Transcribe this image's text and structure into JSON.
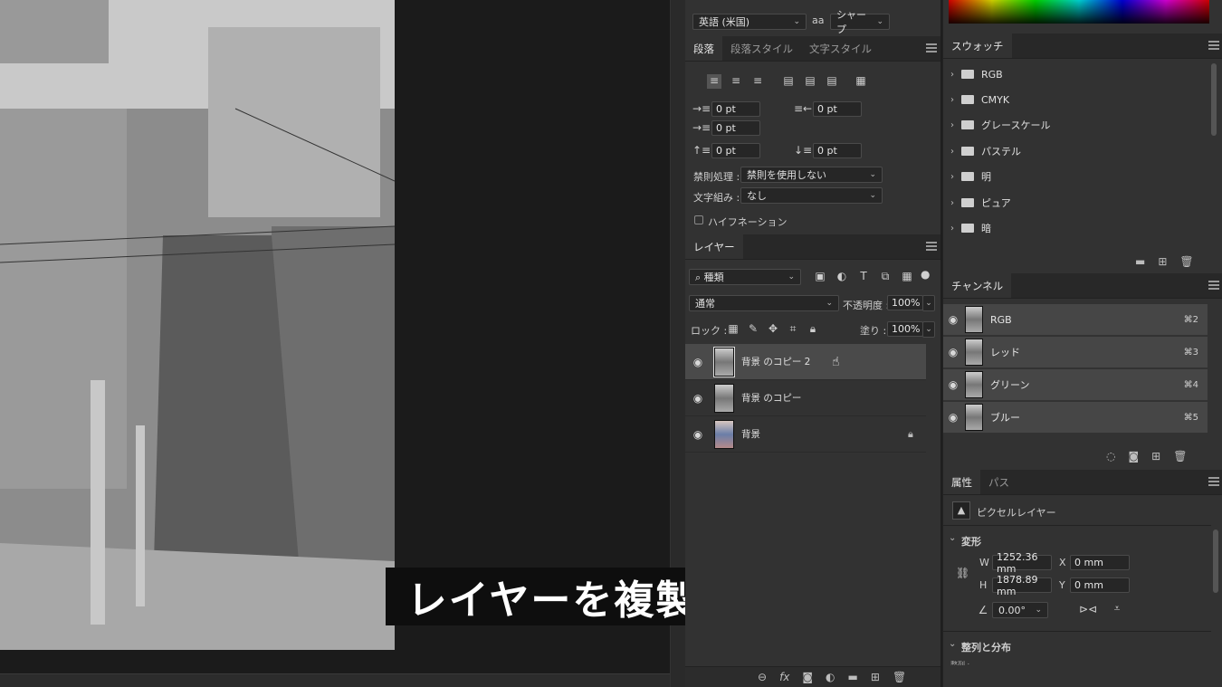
{
  "subtitle": "レイヤーを複製します",
  "character": {
    "language_dropdown": "英語 (米国)",
    "aa_icon": "aa",
    "antialias_dropdown": "シャープ"
  },
  "paragraph_panel": {
    "tabs": [
      "段落",
      "段落スタイル",
      "文字スタイル"
    ],
    "indent_left": "0 pt",
    "indent_right": "0 pt",
    "indent_first": "0 pt",
    "space_before": "0 pt",
    "space_after": "0 pt",
    "kinsoku_label": "禁則処理 :",
    "kinsoku_value": "禁則を使用しない",
    "mojikumi_label": "文字組み :",
    "mojikumi_value": "なし",
    "hyphenation_label": "ハイフネーション"
  },
  "layers_panel": {
    "tab": "レイヤー",
    "filter_label": "種類",
    "blend_mode": "通常",
    "opacity_label": "不透明度 :",
    "opacity_value": "100%",
    "lock_label": "ロック :",
    "fill_label": "塗り :",
    "fill_value": "100%",
    "layers": [
      {
        "name": "背景 のコピー 2",
        "selected": true,
        "locked": false
      },
      {
        "name": "背景 のコピー",
        "selected": false,
        "locked": false
      },
      {
        "name": "背景",
        "selected": false,
        "locked": true
      }
    ],
    "footer_icons": [
      "link-icon",
      "fx-icon",
      "mask-icon",
      "adjustment-icon",
      "folder-icon",
      "new-layer-icon",
      "trash-icon"
    ]
  },
  "swatches_panel": {
    "tab": "スウォッチ",
    "groups": [
      "RGB",
      "CMYK",
      "グレースケール",
      "パステル",
      "明",
      "ピュア",
      "暗"
    ]
  },
  "channels_panel": {
    "tab": "チャンネル",
    "channels": [
      {
        "name": "RGB",
        "shortcut": "⌘2"
      },
      {
        "name": "レッド",
        "shortcut": "⌘3"
      },
      {
        "name": "グリーン",
        "shortcut": "⌘4"
      },
      {
        "name": "ブルー",
        "shortcut": "⌘5"
      }
    ]
  },
  "properties_panel": {
    "tabs": [
      "属性",
      "パス"
    ],
    "kind": "ピクセルレイヤー",
    "transform_label": "変形",
    "w_label": "W",
    "w_value": "1252.36 mm",
    "h_label": "H",
    "h_value": "1878.89 mm",
    "x_label": "X",
    "x_value": "0 mm",
    "y_label": "Y",
    "y_value": "0 mm",
    "angle_value": "0.00°",
    "align_label": "整列と分布",
    "align_sub": "整列 :"
  },
  "colors": {
    "panel_bg": "#323232",
    "tab_bg": "#282828",
    "selected_row": "#4a4a4a",
    "canvas_bg": "#1b1b1b"
  }
}
